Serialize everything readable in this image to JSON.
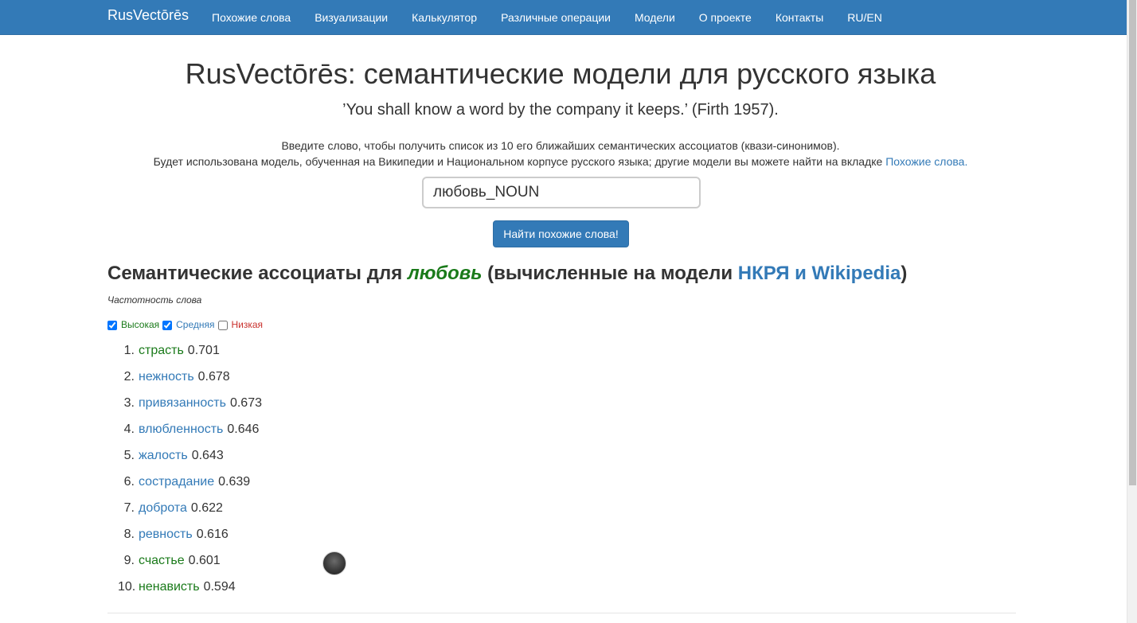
{
  "navbar": {
    "brand": "RusVectōrēs",
    "items": [
      "Похожие слова",
      "Визуализации",
      "Калькулятор",
      "Различные операции",
      "Модели",
      "О проекте",
      "Контакты",
      "RU/EN"
    ]
  },
  "header": {
    "title": "RusVectōrēs: семантические модели для русского языка",
    "quote": "’You shall know a word by the company it keeps.’ (Firth 1957).",
    "intro_line1": "Введите слово, чтобы получить список из 10 его ближайших семантических ассоциатов (квази-синонимов).",
    "intro_line2": "Будет использована модель, обученная на Википедии и Национальном корпусе русского языка; другие модели вы можете найти на вкладке ",
    "intro_link": "Похожие слова."
  },
  "search": {
    "value": "любовь_NOUN",
    "button_label": "Найти похожие слова!"
  },
  "results": {
    "heading_prefix": "Семантические ассоциаты для ",
    "word": "любовь",
    "heading_middle": " (вычисленные на модели ",
    "model": "НКРЯ и Wikipedia",
    "heading_suffix": ")",
    "freq_label": "Частотность слова",
    "filters": {
      "high": "Высокая",
      "mid": "Средняя",
      "low": "Низкая"
    },
    "items": [
      {
        "num": "1.",
        "word": "страсть",
        "score": "0.701",
        "freq": "high"
      },
      {
        "num": "2.",
        "word": "нежность",
        "score": "0.678",
        "freq": "mid"
      },
      {
        "num": "3.",
        "word": "привязанность",
        "score": "0.673",
        "freq": "mid"
      },
      {
        "num": "4.",
        "word": "влюбленность",
        "score": "0.646",
        "freq": "mid"
      },
      {
        "num": "5.",
        "word": "жалость",
        "score": "0.643",
        "freq": "mid"
      },
      {
        "num": "6.",
        "word": "сострадание",
        "score": "0.639",
        "freq": "mid"
      },
      {
        "num": "7.",
        "word": "доброта",
        "score": "0.622",
        "freq": "mid"
      },
      {
        "num": "8.",
        "word": "ревность",
        "score": "0.616",
        "freq": "mid"
      },
      {
        "num": "9.",
        "word": "счастье",
        "score": "0.601",
        "freq": "high"
      },
      {
        "num": "10.",
        "word": "ненависть",
        "score": "0.594",
        "freq": "high"
      }
    ]
  },
  "colors": {
    "navbar": "#337ab7",
    "high": "#1a7a1a",
    "mid": "#337ab7",
    "low": "#c9302c"
  }
}
